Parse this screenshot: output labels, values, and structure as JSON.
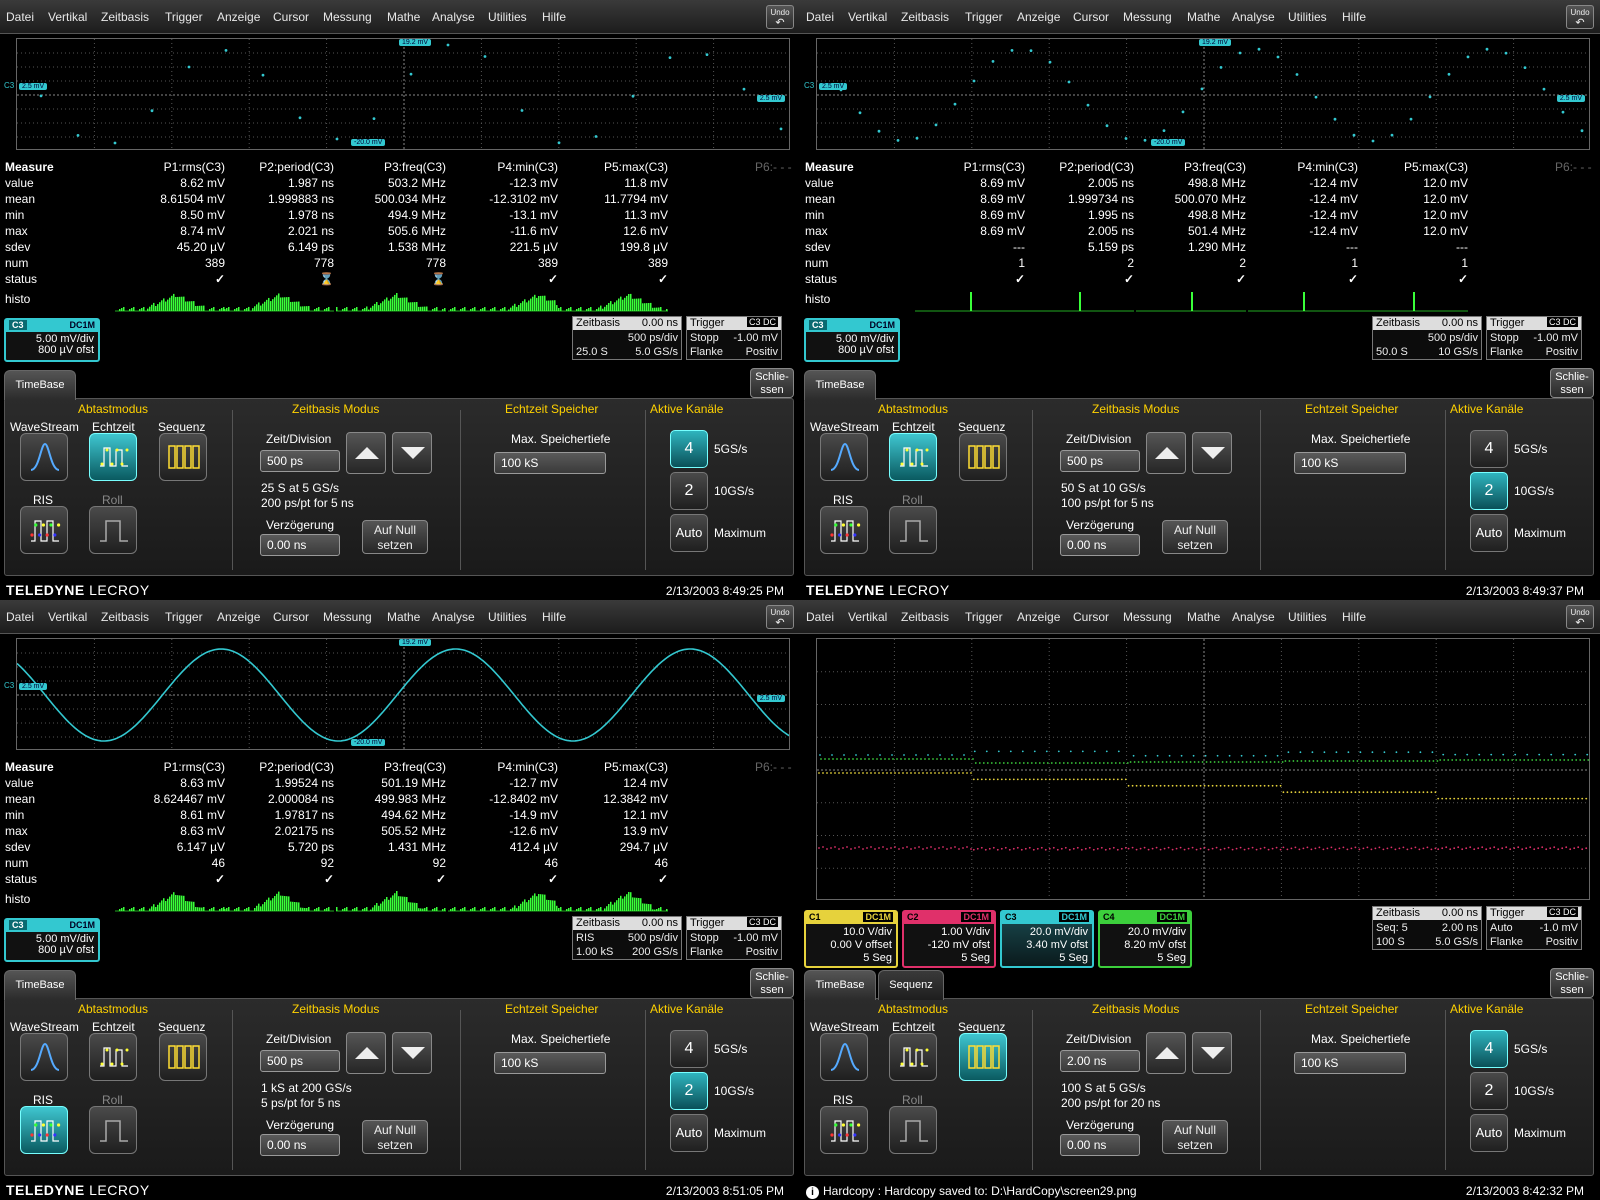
{
  "menu": [
    "Datei",
    "Vertikal",
    "Zeitbasis",
    "Trigger",
    "Anzeige",
    "Cursor",
    "Messung",
    "Mathe",
    "Analyse",
    "Utilities",
    "Hilfe"
  ],
  "undo": "Undo",
  "tags": {
    "top": "19.2 mV",
    "left": "2.5 mV",
    "right": "2.5 mV",
    "bottom": "-20.0 mV",
    "ch": "C3"
  },
  "rows": [
    "Measure",
    "value",
    "mean",
    "min",
    "max",
    "sdev",
    "num",
    "status"
  ],
  "histo_label": "histo",
  "headers": [
    "P1:rms(C3)",
    "P2:period(C3)",
    "P3:freq(C3)",
    "P4:min(C3)",
    "P5:max(C3)"
  ],
  "p6": "P6:- - -",
  "panel": {
    "tab_timebase": "TimeBase",
    "tab_sequenz": "Sequenz",
    "close": "Schlie-\nssen",
    "abtast": "Abtastmodus",
    "zeitmodus": "Zeitbasis Modus",
    "speicher": "Echtzeit Speicher",
    "kanaele": "Aktive Kanäle",
    "wavestream": "WaveStream",
    "echtzeit": "Echtzeit",
    "sequenz": "Sequenz",
    "ris": "RIS",
    "roll": "Roll",
    "zeitdiv": "Zeit/Division",
    "verz": "Verzögerung",
    "aufnull1": "Auf Null",
    "aufnull2": "setzen",
    "maxspeicher": "Max. Speichertiefe",
    "memval": "100 kS",
    "ch4": "4",
    "ch2": "2",
    "auto": "Auto",
    "rate4": "5GS/s",
    "rate2": "10GS/s",
    "ratemax": "Maximum",
    "delay": "0.00 ns"
  },
  "logo": {
    "a": "TELEDYNE",
    "b": "LECROY"
  },
  "q1": {
    "cells": [
      [
        "8.62 mV",
        "1.987 ns",
        "503.2 MHz",
        "-12.3 mV",
        "11.8 mV"
      ],
      [
        "8.61504 mV",
        "1.999883 ns",
        "500.034 MHz",
        "-12.3102 mV",
        "11.7794 mV"
      ],
      [
        "8.50 mV",
        "1.978 ns",
        "494.9 MHz",
        "-13.1 mV",
        "11.3 mV"
      ],
      [
        "8.74 mV",
        "2.021 ns",
        "505.6 MHz",
        "-11.6 mV",
        "12.6 mV"
      ],
      [
        "45.20 µV",
        "6.149 ps",
        "1.538 MHz",
        "221.5 µV",
        "199.8 µV"
      ],
      [
        "389",
        "778",
        "778",
        "389",
        "389"
      ]
    ],
    "ch": {
      "n": "C3",
      "c": "DC1M",
      "l1": "5.00 mV/div",
      "l2": "800 µV ofst"
    },
    "tb": {
      "h": "Zeitbasis",
      "hv": "0.00 ns",
      "r1": "500 ps/div",
      "r2a": "25.0 S",
      "r2b": "5.0 GS/s"
    },
    "tr": {
      "h": "Trigger",
      "cc": "C3 DC",
      "r1a": "Stopp",
      "r1b": "-1.00 mV",
      "r2a": "Flanke",
      "r2b": "Positiv"
    },
    "tdiv": "500 ps",
    "info1": "25 S at 5 GS/s",
    "info2": "200 ps/pt for 5 ns",
    "date": "2/13/2003 8:49:25 PM"
  },
  "q2": {
    "cells": [
      [
        "8.69 mV",
        "2.005 ns",
        "498.8 MHz",
        "-12.4 mV",
        "12.0 mV"
      ],
      [
        "8.69 mV",
        "1.999734 ns",
        "500.070 MHz",
        "-12.4 mV",
        "12.0 mV"
      ],
      [
        "8.69 mV",
        "1.995 ns",
        "498.8 MHz",
        "-12.4 mV",
        "12.0 mV"
      ],
      [
        "8.69 mV",
        "2.005 ns",
        "501.4 MHz",
        "-12.4 mV",
        "12.0 mV"
      ],
      [
        "---",
        "5.159 ps",
        "1.290 MHz",
        "---",
        "---"
      ],
      [
        "1",
        "2",
        "2",
        "1",
        "1"
      ]
    ],
    "ch": {
      "n": "C3",
      "c": "DC1M",
      "l1": "5.00 mV/div",
      "l2": "800 µV ofst"
    },
    "tb": {
      "h": "Zeitbasis",
      "hv": "0.00 ns",
      "r1": "500 ps/div",
      "r2a": "50.0 S",
      "r2b": "10 GS/s"
    },
    "tr": {
      "h": "Trigger",
      "cc": "C3 DC",
      "r1a": "Stopp",
      "r1b": "-1.00 mV",
      "r2a": "Flanke",
      "r2b": "Positiv"
    },
    "tdiv": "500 ps",
    "info1": "50 S at 10 GS/s",
    "info2": "100 ps/pt for 5 ns",
    "date": "2/13/2003 8:49:37 PM"
  },
  "q3": {
    "cells": [
      [
        "8.63 mV",
        "1.99524 ns",
        "501.19 MHz",
        "-12.7 mV",
        "12.4 mV"
      ],
      [
        "8.624467 mV",
        "2.000084 ns",
        "499.983 MHz",
        "-12.8402 mV",
        "12.3842 mV"
      ],
      [
        "8.61 mV",
        "1.97817 ns",
        "494.62 MHz",
        "-14.9 mV",
        "12.1 mV"
      ],
      [
        "8.63 mV",
        "2.02175 ns",
        "505.52 MHz",
        "-12.6 mV",
        "13.9 mV"
      ],
      [
        "6.147 µV",
        "5.720 ps",
        "1.431 MHz",
        "412.4 µV",
        "294.7 µV"
      ],
      [
        "46",
        "92",
        "92",
        "46",
        "46"
      ]
    ],
    "ch": {
      "n": "C3",
      "c": "DC1M",
      "l1": "5.00 mV/div",
      "l2": "800 µV ofst"
    },
    "tb": {
      "h": "Zeitbasis",
      "hv": "0.00 ns",
      "r1a": "RIS",
      "r1": "500 ps/div",
      "r2a": "1.00 kS",
      "r2b": "200 GS/s"
    },
    "tr": {
      "h": "Trigger",
      "cc": "C3 DC",
      "r1a": "Stopp",
      "r1b": "-1.00 mV",
      "r2a": "Flanke",
      "r2b": "Positiv"
    },
    "tdiv": "500 ps",
    "info1": "1 kS at 200 GS/s",
    "info2": "5 ps/pt for 5 ns",
    "date": "2/13/2003 8:51:05 PM"
  },
  "q4": {
    "channels": [
      {
        "n": "C1",
        "c": "DC1M",
        "l1": "10.0 V/div",
        "l2": "0.00 V offset",
        "l3": "5 Seg"
      },
      {
        "n": "C2",
        "c": "DC1M",
        "l1": "1.00 V/div",
        "l2": "-120 mV ofst",
        "l3": "5 Seg"
      },
      {
        "n": "C3",
        "c": "DC1M",
        "l1": "20.0 mV/div",
        "l2": "3.40 mV ofst",
        "l3": "5 Seg"
      },
      {
        "n": "C4",
        "c": "DC1M",
        "l1": "20.0 mV/div",
        "l2": "8.20 mV ofst",
        "l3": "5 Seg"
      }
    ],
    "tb": {
      "h": "Zeitbasis",
      "hv": "0.00 ns",
      "r1a": "Seq: 5",
      "r1": "2.00 ns",
      "r2a": "100 S",
      "r2b": "5.0 GS/s"
    },
    "tr": {
      "h": "Trigger",
      "cc": "C3 DC",
      "r1a": "Auto",
      "r1b": "-1.0 mV",
      "r2a": "Flanke",
      "r2b": "Positiv"
    },
    "tdiv": "2.00 ns",
    "info1": "100 S at 5 GS/s",
    "info2": "200 ps/pt for 20 ns",
    "msg": "Hardcopy : Hardcopy saved to: D:\\HardCopy\\screen29.png",
    "date": "2/13/2003 8:42:32 PM"
  },
  "colors": {
    "accent": "#33c8d0",
    "trace": "#33c8d0",
    "histo": "#39ff39",
    "label": "#ffd200"
  }
}
